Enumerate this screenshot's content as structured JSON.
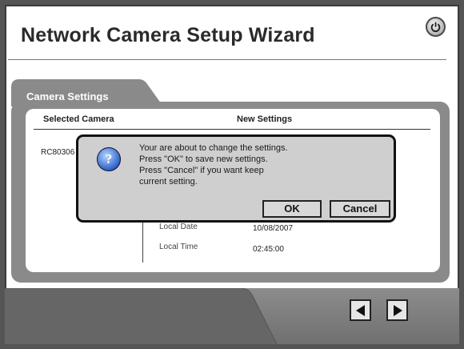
{
  "window": {
    "title": "Network Camera Setup Wizard"
  },
  "panel": {
    "tab_label": "Camera Settings",
    "headers": {
      "selected_camera": "Selected Camera",
      "new_settings": "New Settings"
    },
    "camera_name": "RC80306",
    "rows": [
      {
        "label": "Local Date",
        "value": "10/08/2007"
      },
      {
        "label": "Local Time",
        "value": "02:45:00"
      }
    ]
  },
  "dialog": {
    "icon": "question-icon",
    "icon_glyph": "?",
    "lines": [
      "Your are about to change the settings.",
      "Press \"OK\" to save new settings.",
      "Press \"Cancel\" if you want keep",
      "current setting."
    ],
    "ok_label": "OK",
    "cancel_label": "Cancel"
  },
  "nav": {
    "back_icon": "triangle-left-icon",
    "next_icon": "triangle-right-icon"
  },
  "power_icon": "power-icon"
}
